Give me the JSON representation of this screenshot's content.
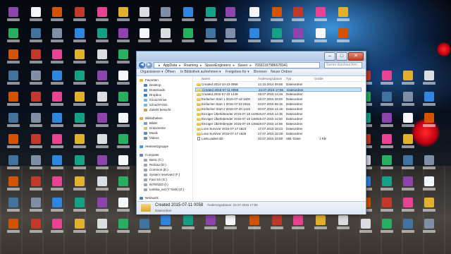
{
  "window": {
    "address_parts": [
      "AppData",
      "Roaming",
      "SpaceEngineers",
      "Saves",
      "76561197986678341"
    ],
    "search_placeholder": "Saves durchsuchen",
    "toolbar": {
      "organize": "Organisieren ▾",
      "open": "Öffnen",
      "library": "In Bibliothek aufnehmen ▾",
      "share": "Freigeben für ▾",
      "burn": "Brennen",
      "new_folder": "Neuer Ordner"
    },
    "sidebar": {
      "favorites_header": "Favoriten",
      "favorites": [
        "Desktop",
        "Downloads",
        "Dropbox",
        "iCloud Drive",
        "iCloud-Fotos",
        "Zuletzt besucht"
      ],
      "libraries_header": "Bibliotheken",
      "libraries": [
        "Bilder",
        "Dokumente",
        "Musik",
        "Videos"
      ],
      "homegroup": "Heimnetzgruppe",
      "computer_header": "Computer",
      "drives": [
        "Basic (C:)",
        "Relican (D:)",
        "Common (E:)",
        "System reserviert (F:)",
        "Fast SS (G:)",
        "INTENSO (I:)",
        "toshiba_ext (Y:Tosh) (Z:)"
      ],
      "network": "Netzwerk"
    },
    "columns": {
      "name": "Name",
      "date": "Änderungsdatum",
      "type": "Typ",
      "size": "Größe"
    },
    "files": [
      {
        "name": "Created 2014-10-13 0958",
        "date": "12.10.2014 09:58",
        "type": "Dateiordner",
        "size": "",
        "kind": "folder",
        "selected": false
      },
      {
        "name": "Created 2015-07-11 0058",
        "date": "24.07.2015 17:56",
        "type": "Dateiordner",
        "size": "",
        "kind": "folder",
        "selected": true
      },
      {
        "name": "Created 2015-07-10 1449",
        "date": "19.07.2015 14:49",
        "type": "Dateiordner",
        "size": "",
        "kind": "folder",
        "selected": false
      },
      {
        "name": "Einfacher Start 1 2015-07-18 1600",
        "date": "18.07.2015 16:00",
        "type": "Dateiordner",
        "size": "",
        "kind": "folder",
        "selected": false
      },
      {
        "name": "Einfacher Start 1 2015-07-22 0815",
        "date": "22.07.2015 08:15",
        "type": "Dateiordner",
        "size": "",
        "kind": "folder",
        "selected": false
      },
      {
        "name": "Einfacher Start 2 2015-07-20 1415",
        "date": "20.07.2015 14:15",
        "type": "Dateiordner",
        "size": "",
        "kind": "folder",
        "selected": false
      },
      {
        "name": "Einziger Überlebender 2015-07-19 1436",
        "date": "19.07.2015 14:36",
        "type": "Dateiordner",
        "size": "",
        "kind": "folder",
        "selected": false
      },
      {
        "name": "Einziger Überlebender 2015-07-19 1450",
        "date": "19.07.2015 14:50",
        "type": "Dateiordner",
        "size": "",
        "kind": "folder",
        "selected": false
      },
      {
        "name": "Einziger Überlebender 2015-07-19 1456",
        "date": "19.07.2015 14:56",
        "type": "Dateiordner",
        "size": "",
        "kind": "folder",
        "selected": false
      },
      {
        "name": "Lone Survivor 2015-07-17 1823",
        "date": "17.07.2015 18:23",
        "type": "Dateiordner",
        "size": "",
        "kind": "folder",
        "selected": false
      },
      {
        "name": "Lone Survivor 2015-07-17 1828",
        "date": "17.07.2015 18:28",
        "type": "Dateiordner",
        "size": "",
        "kind": "folder",
        "selected": false
      },
      {
        "name": "LastLoaded.sbl",
        "date": "20.07.2015 15:59",
        "type": "SBL-Datei",
        "size": "1 KB",
        "kind": "file",
        "selected": false
      }
    ],
    "details": {
      "name": "Created 2015-07-11 0058",
      "meta": "Änderungsdatum: 24.07.2015 17:56",
      "type": "Dateiordner"
    }
  },
  "colors": {
    "selection": "#cce4fa",
    "folder": "#e9c04f",
    "accent": "#3a78c4"
  }
}
